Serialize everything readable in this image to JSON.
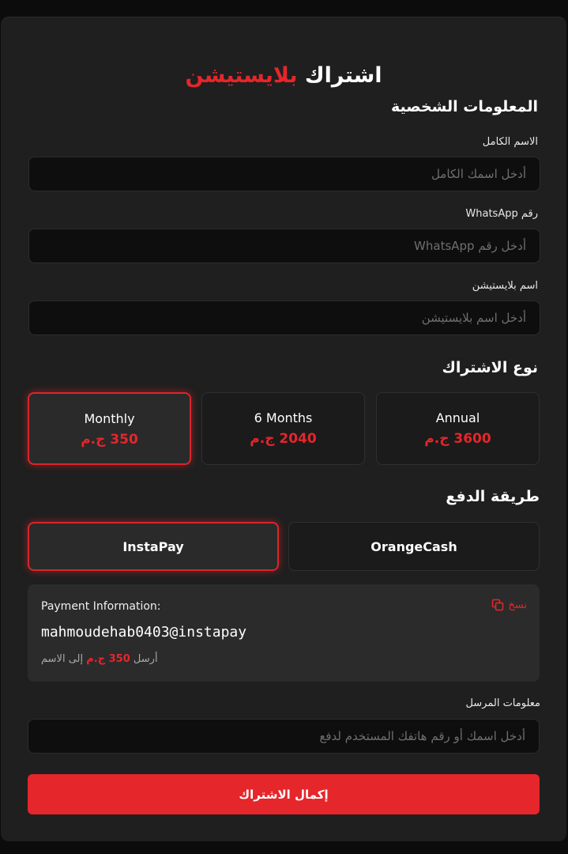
{
  "header": {
    "title_main": "اشتراك",
    "title_accent": "بلايستيشن"
  },
  "personal": {
    "section_title": "المعلومات الشخصية",
    "name_label": "الاسم الكامل",
    "name_placeholder": "أدخل اسمك الكامل",
    "whatsapp_label": "رقم WhatsApp",
    "whatsapp_placeholder": "أدخل رقم WhatsApp",
    "psn_label": "اسم بلايستيشن",
    "psn_placeholder": "أدخل اسم بلايستيشن"
  },
  "subscription": {
    "section_title": "نوع الاشتراك",
    "plans": [
      {
        "name": "Monthly",
        "price": "350 ج.م",
        "price_value": 350,
        "selected": true
      },
      {
        "name": "6 Months",
        "price": "2040 ج.م",
        "price_value": 2040,
        "selected": false
      },
      {
        "name": "Annual",
        "price": "3600 ج.م",
        "price_value": 3600,
        "selected": false
      }
    ]
  },
  "payment": {
    "section_title": "طريقة الدفع",
    "methods": [
      {
        "name": "InstaPay",
        "selected": true
      },
      {
        "name": "OrangeCash",
        "selected": false
      }
    ],
    "info_title": "Payment Information:",
    "copy_label": "نسخ",
    "account": "mahmoudehab0403@instapay",
    "note_prefix": "أرسل",
    "note_amount": "350 ج.م",
    "note_suffix": "إلى الاسم"
  },
  "sender": {
    "label": "معلومات المرسل",
    "placeholder": "أدخل اسمك أو رقم هاتفك المستخدم لدفع"
  },
  "submit_label": "إكمال الاشتراك",
  "colors": {
    "accent": "#e5262b",
    "background": "#0c0c0c",
    "card": "#1f1f1f"
  }
}
